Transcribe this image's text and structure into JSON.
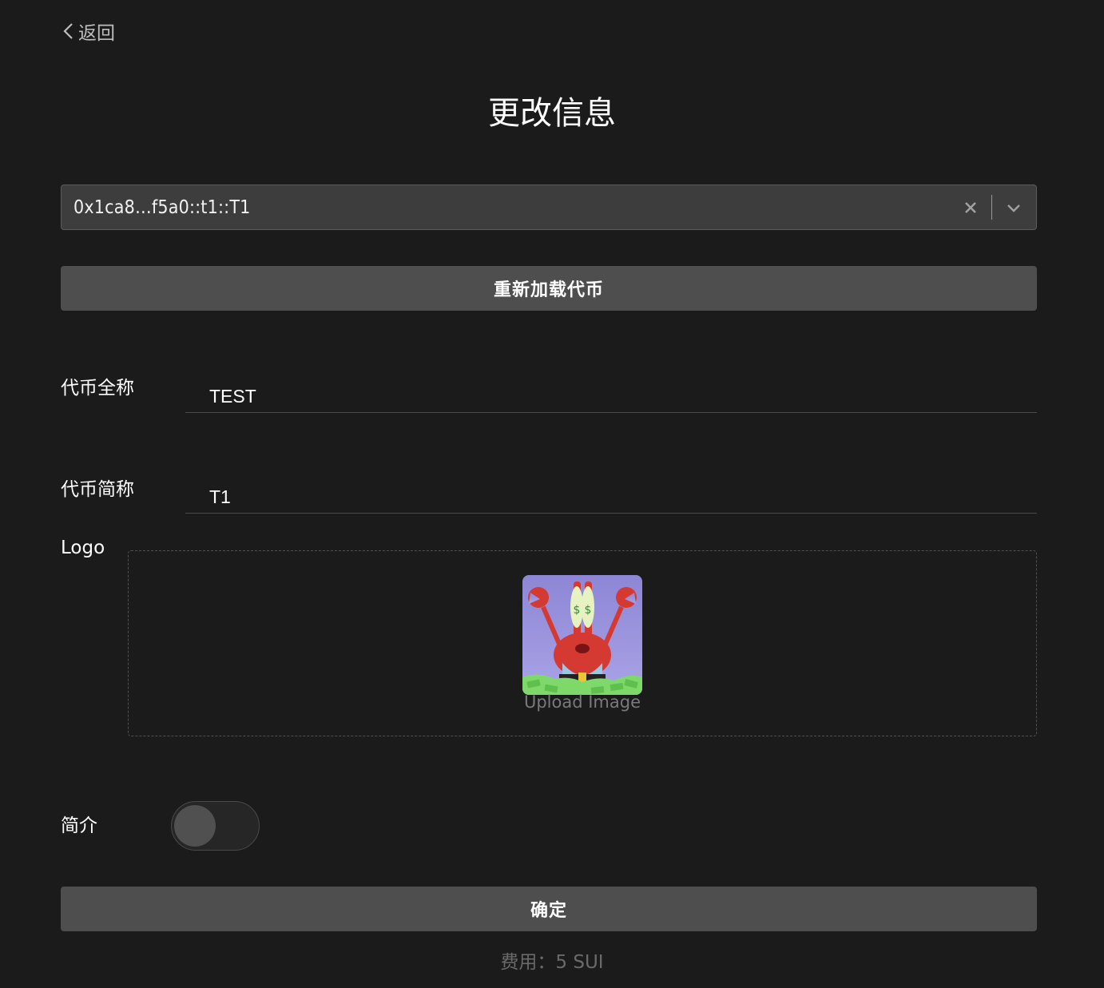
{
  "header": {
    "back_label": "返回",
    "title": "更改信息"
  },
  "token_select": {
    "value": "0x1ca8…f5a0::t1::T1",
    "clear_icon": "close-icon",
    "dropdown_icon": "chevron-down-icon"
  },
  "reload_button": {
    "label": "重新加载代币"
  },
  "form": {
    "full_name": {
      "label": "代币全称",
      "value": "TEST"
    },
    "symbol": {
      "label": "代币简称",
      "value": "T1"
    },
    "logo": {
      "label": "Logo",
      "upload_text": "Upload Image"
    },
    "description": {
      "label": "简介",
      "toggle_on": false
    }
  },
  "confirm_button": {
    "label": "确定"
  },
  "fee": {
    "text": "费用：5 SUI"
  },
  "colors": {
    "background": "#1b1b1b",
    "button": "#4e4e4e",
    "select_bg": "#3d3d3d"
  }
}
